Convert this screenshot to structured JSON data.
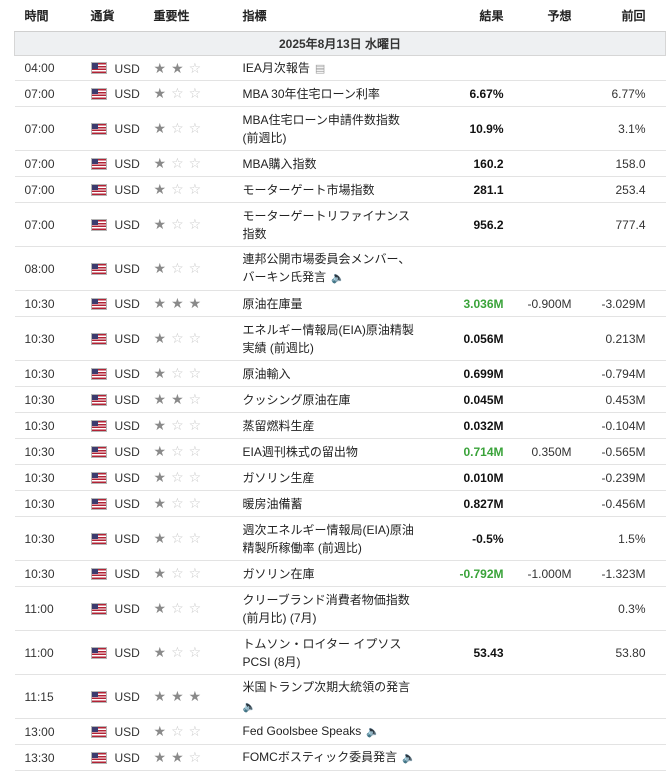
{
  "columns": {
    "time": "時間",
    "currency": "通貨",
    "importance": "重要性",
    "event": "指標",
    "actual": "結果",
    "forecast": "予想",
    "previous": "前回"
  },
  "date_label": "2025年8月13日 水曜日",
  "colors": {
    "positive_actual": "#3aa33a",
    "star_on": "#8a8a8a",
    "star_off": "#c8c8c8"
  },
  "rows": [
    {
      "time": "04:00",
      "currency": "USD",
      "stars": 2,
      "event": "IEA月次報告",
      "icon": "report-icon",
      "actual": "",
      "forecast": "",
      "previous": "",
      "green": false
    },
    {
      "time": "07:00",
      "currency": "USD",
      "stars": 1,
      "event": "MBA 30年住宅ローン利率",
      "icon": "",
      "actual": "6.67%",
      "forecast": "",
      "previous": "6.77%",
      "green": false
    },
    {
      "time": "07:00",
      "currency": "USD",
      "stars": 1,
      "event": "MBA住宅ローン申請件数指数 (前週比)",
      "icon": "",
      "actual": "10.9%",
      "forecast": "",
      "previous": "3.1%",
      "green": false
    },
    {
      "time": "07:00",
      "currency": "USD",
      "stars": 1,
      "event": "MBA購入指数",
      "icon": "",
      "actual": "160.2",
      "forecast": "",
      "previous": "158.0",
      "green": false
    },
    {
      "time": "07:00",
      "currency": "USD",
      "stars": 1,
      "event": "モーターゲート市場指数",
      "icon": "",
      "actual": "281.1",
      "forecast": "",
      "previous": "253.4",
      "green": false
    },
    {
      "time": "07:00",
      "currency": "USD",
      "stars": 1,
      "event": "モーターゲートリファイナンス指数",
      "icon": "",
      "actual": "956.2",
      "forecast": "",
      "previous": "777.4",
      "green": false
    },
    {
      "time": "08:00",
      "currency": "USD",
      "stars": 1,
      "event": "連邦公開市場委員会メンバー、バーキン氏発言",
      "icon": "speaker-icon",
      "actual": "",
      "forecast": "",
      "previous": "",
      "green": false
    },
    {
      "time": "10:30",
      "currency": "USD",
      "stars": 3,
      "event": "原油在庫量",
      "icon": "",
      "actual": "3.036M",
      "forecast": "-0.900M",
      "previous": "-3.029M",
      "green": true
    },
    {
      "time": "10:30",
      "currency": "USD",
      "stars": 1,
      "event": "エネルギー情報局(EIA)原油精製実績 (前週比)",
      "icon": "",
      "actual": "0.056M",
      "forecast": "",
      "previous": "0.213M",
      "green": false
    },
    {
      "time": "10:30",
      "currency": "USD",
      "stars": 1,
      "event": "原油輸入",
      "icon": "",
      "actual": "0.699M",
      "forecast": "",
      "previous": "-0.794M",
      "green": false
    },
    {
      "time": "10:30",
      "currency": "USD",
      "stars": 2,
      "event": "クッシング原油在庫",
      "icon": "",
      "actual": "0.045M",
      "forecast": "",
      "previous": "0.453M",
      "green": false
    },
    {
      "time": "10:30",
      "currency": "USD",
      "stars": 1,
      "event": "蒸留燃料生産",
      "icon": "",
      "actual": "0.032M",
      "forecast": "",
      "previous": "-0.104M",
      "green": false
    },
    {
      "time": "10:30",
      "currency": "USD",
      "stars": 1,
      "event": "EIA週刊株式の留出物",
      "icon": "",
      "actual": "0.714M",
      "forecast": "0.350M",
      "previous": "-0.565M",
      "green": true
    },
    {
      "time": "10:30",
      "currency": "USD",
      "stars": 1,
      "event": "ガソリン生産",
      "icon": "",
      "actual": "0.010M",
      "forecast": "",
      "previous": "-0.239M",
      "green": false
    },
    {
      "time": "10:30",
      "currency": "USD",
      "stars": 1,
      "event": "暖房油備蓄",
      "icon": "",
      "actual": "0.827M",
      "forecast": "",
      "previous": "-0.456M",
      "green": false
    },
    {
      "time": "10:30",
      "currency": "USD",
      "stars": 1,
      "event": "週次エネルギー情報局(EIA)原油精製所稼働率 (前週比)",
      "icon": "",
      "actual": "-0.5%",
      "forecast": "",
      "previous": "1.5%",
      "green": false
    },
    {
      "time": "10:30",
      "currency": "USD",
      "stars": 1,
      "event": "ガソリン在庫",
      "icon": "",
      "actual": "-0.792M",
      "forecast": "-1.000M",
      "previous": "-1.323M",
      "green": true
    },
    {
      "time": "11:00",
      "currency": "USD",
      "stars": 1,
      "event": "クリーブランド消費者物価指数 (前月比) (7月)",
      "icon": "",
      "actual": "",
      "forecast": "",
      "previous": "0.3%",
      "green": false
    },
    {
      "time": "11:00",
      "currency": "USD",
      "stars": 1,
      "event": "トムソン・ロイター イプソス PCSI (8月)",
      "icon": "",
      "actual": "53.43",
      "forecast": "",
      "previous": "53.80",
      "green": false
    },
    {
      "time": "11:15",
      "currency": "USD",
      "stars": 3,
      "event": "米国トランプ次期大統領の発言",
      "icon": "speaker-icon",
      "actual": "",
      "forecast": "",
      "previous": "",
      "green": false
    },
    {
      "time": "13:00",
      "currency": "USD",
      "stars": 1,
      "event": "Fed Goolsbee Speaks",
      "icon": "speaker-icon",
      "actual": "",
      "forecast": "",
      "previous": "",
      "green": false
    },
    {
      "time": "13:30",
      "currency": "USD",
      "stars": 2,
      "event": "FOMCボスティック委員発言",
      "icon": "speaker-icon",
      "actual": "",
      "forecast": "",
      "previous": "",
      "green": false
    }
  ]
}
